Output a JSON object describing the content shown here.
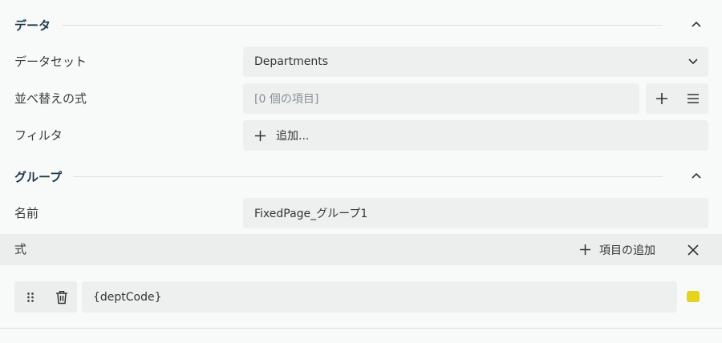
{
  "sections": {
    "data": {
      "title": "データ"
    },
    "group": {
      "title": "グループ"
    }
  },
  "dataset": {
    "label": "データセット",
    "value": "Departments"
  },
  "sort": {
    "label": "並べ替えの式",
    "placeholder": "[0 個の項目]"
  },
  "filter": {
    "label": "フィルタ",
    "add_label": "追加..."
  },
  "name": {
    "label": "名前",
    "value": "FixedPage_グループ1"
  },
  "expression": {
    "label": "式",
    "add_item_label": "項目の追加",
    "items": [
      {
        "value": "{deptCode}",
        "color": "#e6d31c"
      }
    ]
  },
  "colors": {
    "section_title": "#1e3a4a",
    "field_bg": "#eef0f0",
    "page_bg": "#f8f9f9",
    "swatch": "#e6d31c"
  }
}
